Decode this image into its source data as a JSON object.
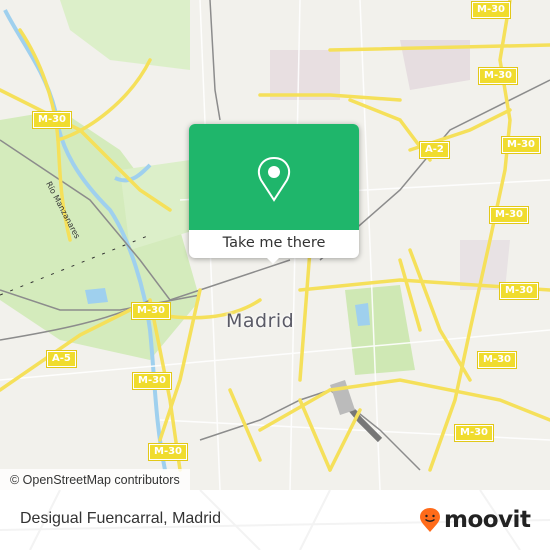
{
  "map": {
    "city_label": "Madrid",
    "river_label": "Río Manzanares",
    "road_shields": [
      {
        "label": "M-30",
        "id": "m30-top-right"
      },
      {
        "label": "M-30",
        "id": "m30-northwest"
      },
      {
        "label": "M-30",
        "id": "m30-northeast"
      },
      {
        "label": "A-2",
        "id": "a2"
      },
      {
        "label": "M-30",
        "id": "m30-east-1"
      },
      {
        "label": "M-30",
        "id": "m30-east-2"
      },
      {
        "label": "M-30",
        "id": "m30-east-3"
      },
      {
        "label": "M-30",
        "id": "m30-east-4"
      },
      {
        "label": "M-30",
        "id": "m30-west-1"
      },
      {
        "label": "A-5",
        "id": "a5"
      },
      {
        "label": "M-30",
        "id": "m30-west-2"
      },
      {
        "label": "M-30",
        "id": "m30-south"
      },
      {
        "label": "M-30",
        "id": "m30-southeast"
      }
    ],
    "attribution": "© OpenStreetMap contributors",
    "colors": {
      "background": "#f2f1ec",
      "park": "#cfe8b4",
      "water": "#9fd0ee",
      "highway": "#f5e05a",
      "rail": "#8c8c8c"
    }
  },
  "popup": {
    "button_label": "Take me there",
    "icon": "map-pin-icon",
    "accent_color": "#1fb66b"
  },
  "footer": {
    "place_title": "Desigual Fuencarral, Madrid",
    "brand": "moovit",
    "brand_icon": "moovit-smiley-pin-icon",
    "brand_color": "#ff6b1a"
  }
}
